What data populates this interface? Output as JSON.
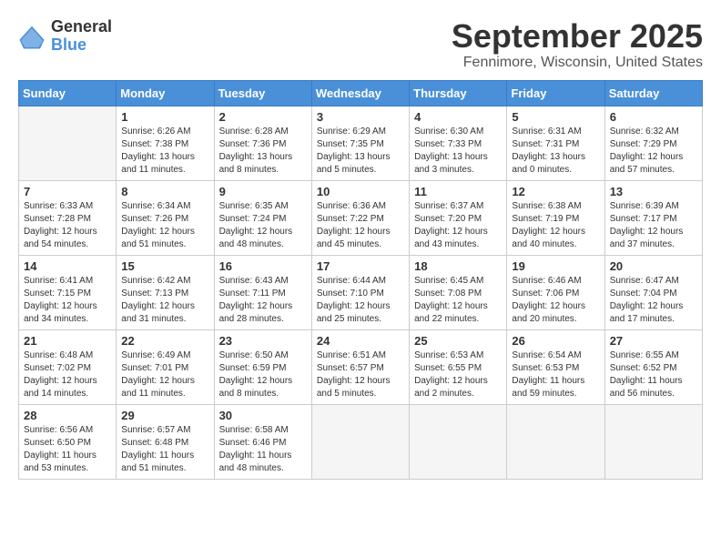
{
  "header": {
    "logo_general": "General",
    "logo_blue": "Blue",
    "month": "September 2025",
    "location": "Fennimore, Wisconsin, United States"
  },
  "days_of_week": [
    "Sunday",
    "Monday",
    "Tuesday",
    "Wednesday",
    "Thursday",
    "Friday",
    "Saturday"
  ],
  "weeks": [
    [
      {
        "day": "",
        "info": ""
      },
      {
        "day": "1",
        "info": "Sunrise: 6:26 AM\nSunset: 7:38 PM\nDaylight: 13 hours\nand 11 minutes."
      },
      {
        "day": "2",
        "info": "Sunrise: 6:28 AM\nSunset: 7:36 PM\nDaylight: 13 hours\nand 8 minutes."
      },
      {
        "day": "3",
        "info": "Sunrise: 6:29 AM\nSunset: 7:35 PM\nDaylight: 13 hours\nand 5 minutes."
      },
      {
        "day": "4",
        "info": "Sunrise: 6:30 AM\nSunset: 7:33 PM\nDaylight: 13 hours\nand 3 minutes."
      },
      {
        "day": "5",
        "info": "Sunrise: 6:31 AM\nSunset: 7:31 PM\nDaylight: 13 hours\nand 0 minutes."
      },
      {
        "day": "6",
        "info": "Sunrise: 6:32 AM\nSunset: 7:29 PM\nDaylight: 12 hours\nand 57 minutes."
      }
    ],
    [
      {
        "day": "7",
        "info": "Sunrise: 6:33 AM\nSunset: 7:28 PM\nDaylight: 12 hours\nand 54 minutes."
      },
      {
        "day": "8",
        "info": "Sunrise: 6:34 AM\nSunset: 7:26 PM\nDaylight: 12 hours\nand 51 minutes."
      },
      {
        "day": "9",
        "info": "Sunrise: 6:35 AM\nSunset: 7:24 PM\nDaylight: 12 hours\nand 48 minutes."
      },
      {
        "day": "10",
        "info": "Sunrise: 6:36 AM\nSunset: 7:22 PM\nDaylight: 12 hours\nand 45 minutes."
      },
      {
        "day": "11",
        "info": "Sunrise: 6:37 AM\nSunset: 7:20 PM\nDaylight: 12 hours\nand 43 minutes."
      },
      {
        "day": "12",
        "info": "Sunrise: 6:38 AM\nSunset: 7:19 PM\nDaylight: 12 hours\nand 40 minutes."
      },
      {
        "day": "13",
        "info": "Sunrise: 6:39 AM\nSunset: 7:17 PM\nDaylight: 12 hours\nand 37 minutes."
      }
    ],
    [
      {
        "day": "14",
        "info": "Sunrise: 6:41 AM\nSunset: 7:15 PM\nDaylight: 12 hours\nand 34 minutes."
      },
      {
        "day": "15",
        "info": "Sunrise: 6:42 AM\nSunset: 7:13 PM\nDaylight: 12 hours\nand 31 minutes."
      },
      {
        "day": "16",
        "info": "Sunrise: 6:43 AM\nSunset: 7:11 PM\nDaylight: 12 hours\nand 28 minutes."
      },
      {
        "day": "17",
        "info": "Sunrise: 6:44 AM\nSunset: 7:10 PM\nDaylight: 12 hours\nand 25 minutes."
      },
      {
        "day": "18",
        "info": "Sunrise: 6:45 AM\nSunset: 7:08 PM\nDaylight: 12 hours\nand 22 minutes."
      },
      {
        "day": "19",
        "info": "Sunrise: 6:46 AM\nSunset: 7:06 PM\nDaylight: 12 hours\nand 20 minutes."
      },
      {
        "day": "20",
        "info": "Sunrise: 6:47 AM\nSunset: 7:04 PM\nDaylight: 12 hours\nand 17 minutes."
      }
    ],
    [
      {
        "day": "21",
        "info": "Sunrise: 6:48 AM\nSunset: 7:02 PM\nDaylight: 12 hours\nand 14 minutes."
      },
      {
        "day": "22",
        "info": "Sunrise: 6:49 AM\nSunset: 7:01 PM\nDaylight: 12 hours\nand 11 minutes."
      },
      {
        "day": "23",
        "info": "Sunrise: 6:50 AM\nSunset: 6:59 PM\nDaylight: 12 hours\nand 8 minutes."
      },
      {
        "day": "24",
        "info": "Sunrise: 6:51 AM\nSunset: 6:57 PM\nDaylight: 12 hours\nand 5 minutes."
      },
      {
        "day": "25",
        "info": "Sunrise: 6:53 AM\nSunset: 6:55 PM\nDaylight: 12 hours\nand 2 minutes."
      },
      {
        "day": "26",
        "info": "Sunrise: 6:54 AM\nSunset: 6:53 PM\nDaylight: 11 hours\nand 59 minutes."
      },
      {
        "day": "27",
        "info": "Sunrise: 6:55 AM\nSunset: 6:52 PM\nDaylight: 11 hours\nand 56 minutes."
      }
    ],
    [
      {
        "day": "28",
        "info": "Sunrise: 6:56 AM\nSunset: 6:50 PM\nDaylight: 11 hours\nand 53 minutes."
      },
      {
        "day": "29",
        "info": "Sunrise: 6:57 AM\nSunset: 6:48 PM\nDaylight: 11 hours\nand 51 minutes."
      },
      {
        "day": "30",
        "info": "Sunrise: 6:58 AM\nSunset: 6:46 PM\nDaylight: 11 hours\nand 48 minutes."
      },
      {
        "day": "",
        "info": ""
      },
      {
        "day": "",
        "info": ""
      },
      {
        "day": "",
        "info": ""
      },
      {
        "day": "",
        "info": ""
      }
    ]
  ]
}
